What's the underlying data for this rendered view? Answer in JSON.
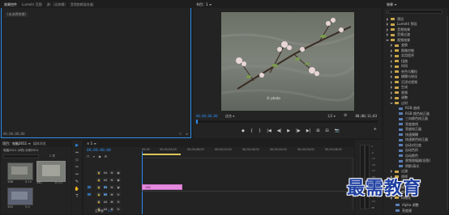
{
  "source_panel": {
    "tabs": [
      "效果控件",
      "Lumetri 范围",
      "源：(无剪辑)",
      "音频剪辑混合器："
    ],
    "message": "(未选择剪辑)",
    "timecode": "00;00;00;00"
  },
  "program_monitor": {
    "title": "节目：1 ≡",
    "timecode_left": "00;00;00;00",
    "fit_label": "适合",
    "quality_label": "1/2",
    "timecode_right": "00;00;11;03",
    "controls": [
      "◆",
      "{",
      "}",
      "|◀",
      "◀|",
      "▶",
      "|▶",
      "▶|",
      "⊞",
      "⊟",
      "📷",
      "+"
    ]
  },
  "project_panel": {
    "tabs": [
      "项目：电脑2011 ≡",
      "媒体浏览",
      "库",
      "信息"
    ],
    "project_name": "电脑2011 (4项) 示例2011",
    "item_count": "2 项",
    "clips": [
      {
        "name": "136",
        "duration": "0;10"
      },
      {
        "name": "141",
        "duration": "10;23"
      },
      {
        "name": "150",
        "duration": "5;4"
      }
    ]
  },
  "tools": [
    "▶",
    "⇔",
    "◇",
    "✂",
    "↔",
    "✎",
    "✋",
    "T"
  ],
  "timeline": {
    "tab": "× 1 ≡",
    "timecode": "00;00;00;00",
    "ruler": [
      "00;00",
      "00;00;04;00",
      "00;00;08;00",
      "00;00;12;00",
      "00;00;16;00",
      "00;00;20;00",
      "00;00;24;00",
      "00;00;28;00"
    ],
    "video_tracks": [
      "V3",
      "V2",
      "V1"
    ],
    "audio_tracks": [
      "A1",
      "A2",
      "A3"
    ],
    "clip_label": "136",
    "master_label": "主声道",
    "master_value": "0.0"
  },
  "effects_panel": {
    "title": "效果 ≡",
    "items": [
      {
        "label": "预设",
        "indent": 0,
        "icon": "folder"
      },
      {
        "label": "Lumetri 预设",
        "indent": 0,
        "icon": "folder"
      },
      {
        "label": "音频效果",
        "indent": 0,
        "icon": "folder"
      },
      {
        "label": "音频过渡",
        "indent": 0,
        "icon": "folder"
      },
      {
        "label": "视频效果",
        "indent": 0,
        "icon": "folder",
        "expanded": true
      },
      {
        "label": "变换",
        "indent": 1,
        "icon": "folder"
      },
      {
        "label": "图像控制",
        "indent": 1,
        "icon": "folder"
      },
      {
        "label": "实用程序",
        "indent": 1,
        "icon": "folder"
      },
      {
        "label": "扭曲",
        "indent": 1,
        "icon": "folder"
      },
      {
        "label": "时间",
        "indent": 1,
        "icon": "folder"
      },
      {
        "label": "杂色与颗粒",
        "indent": 1,
        "icon": "folder"
      },
      {
        "label": "模糊与锐化",
        "indent": 1,
        "icon": "folder"
      },
      {
        "label": "沉浸式视频",
        "indent": 1,
        "icon": "folder"
      },
      {
        "label": "生成",
        "indent": 1,
        "icon": "folder"
      },
      {
        "label": "视频",
        "indent": 1,
        "icon": "folder"
      },
      {
        "label": "调整",
        "indent": 1,
        "icon": "folder"
      },
      {
        "label": "过时",
        "indent": 1,
        "icon": "folder",
        "expanded": true
      },
      {
        "label": "RGB 曲线",
        "indent": 2,
        "icon": "fx"
      },
      {
        "label": "RGB 颜色校正器",
        "indent": 2,
        "icon": "fx"
      },
      {
        "label": "三向颜色校正器",
        "indent": 2,
        "icon": "fx"
      },
      {
        "label": "亮度曲线",
        "indent": 2,
        "icon": "fx"
      },
      {
        "label": "亮度校正器",
        "indent": 2,
        "icon": "fx"
      },
      {
        "label": "快速模糊",
        "indent": 2,
        "icon": "fx"
      },
      {
        "label": "快速颜色校正器",
        "indent": 2,
        "icon": "fx"
      },
      {
        "label": "自动对比度",
        "indent": 2,
        "icon": "fx"
      },
      {
        "label": "自动色阶",
        "indent": 2,
        "icon": "fx"
      },
      {
        "label": "自动颜色",
        "indent": 2,
        "icon": "fx"
      },
      {
        "label": "视频限幅器(旧版)",
        "indent": 2,
        "icon": "fx"
      },
      {
        "label": "阴影/高光",
        "indent": 2,
        "icon": "fx"
      },
      {
        "label": "过渡",
        "indent": 1,
        "icon": "folder"
      },
      {
        "label": "透视",
        "indent": 1,
        "icon": "folder"
      },
      {
        "label": "通道",
        "indent": 1,
        "icon": "folder"
      },
      {
        "label": "键控",
        "indent": 1,
        "icon": "folder"
      },
      {
        "label": "颜色校正",
        "indent": 1,
        "icon": "folder"
      },
      {
        "label": "风格化",
        "indent": 1,
        "icon": "folder"
      }
    ],
    "bottom_items": [
      "Alpha 调整",
      "亮度键"
    ]
  },
  "audio_meter_scale": [
    "0",
    "-6",
    "-12",
    "-18",
    "-24",
    "-30",
    "-36",
    "-42",
    "-48",
    "-54",
    "dB"
  ],
  "watermark": "最需教育",
  "colors": {
    "accent": "#2d8ceb",
    "clip": "#e68ae0",
    "folder": "#c9a64c"
  }
}
